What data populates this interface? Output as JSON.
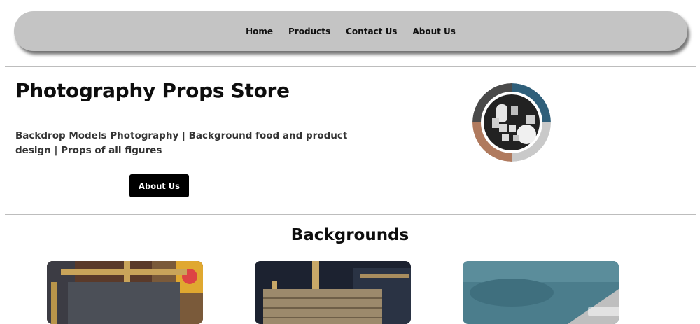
{
  "nav": {
    "items": [
      {
        "label": "Home"
      },
      {
        "label": "Products"
      },
      {
        "label": "Contact Us"
      },
      {
        "label": "About Us"
      }
    ]
  },
  "hero": {
    "title": "Photography Props Store",
    "description": "Backdrop Models Photography | Background food and product design | Props of all figures",
    "button_label": "About Us",
    "logo_icon": "camera-props-logo-icon"
  },
  "section": {
    "title": "Backgrounds"
  },
  "products": [
    {
      "image_icon": "dark-backdrop-on-easel-image"
    },
    {
      "image_icon": "wooden-backdrop-on-easel-image"
    },
    {
      "image_icon": "teal-concrete-backdrop-image"
    }
  ],
  "colors": {
    "navbar_bg": "#c4c4c4",
    "button_bg": "#000000",
    "button_text": "#ffffff",
    "text_dark": "#0d0d0d",
    "rule": "#bdbdbd"
  }
}
